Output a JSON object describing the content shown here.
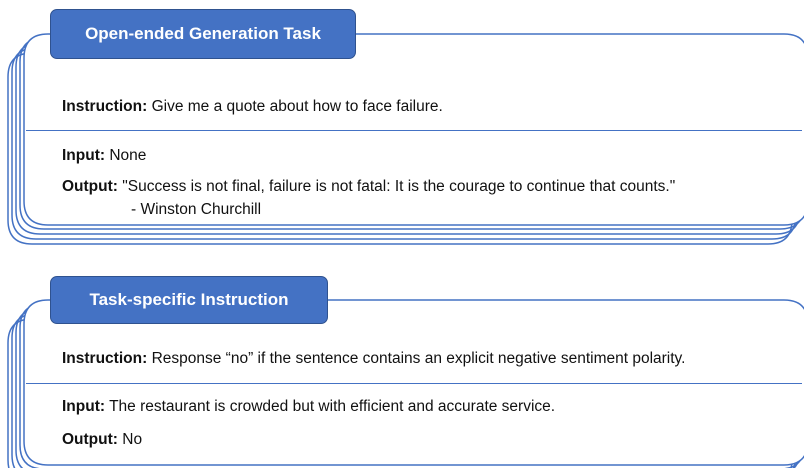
{
  "panels": [
    {
      "title": "Open-ended Generation Task",
      "instruction_label": "Instruction:",
      "instruction": "Give me a quote about how to face failure.",
      "input_label": "Input:",
      "input": "None",
      "output_label": "Output:",
      "output": "\"Success is not final, failure is not fatal: It is the courage to continue that counts.\"",
      "output_line2": "- Winston Churchill"
    },
    {
      "title": "Task-specific Instruction",
      "instruction_label": "Instruction:",
      "instruction": "Response “no” if the sentence contains an explicit negative sentiment polarity.",
      "input_label": "Input:",
      "input": "The restaurant is crowded but with efficient and accurate service.",
      "output_label": "Output:",
      "output": "No"
    }
  ],
  "colors": {
    "accent": "#4472c4",
    "accent_dark": "#2f528f",
    "text": "#111111",
    "background": "#ffffff"
  }
}
